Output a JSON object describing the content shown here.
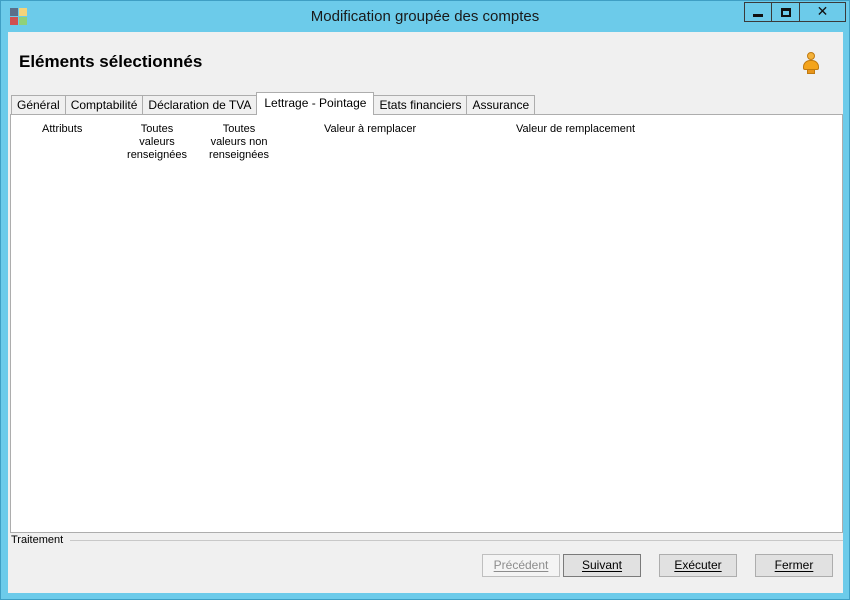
{
  "window": {
    "title": "Modification groupée des comptes",
    "controls": {
      "minimize": "minimize-icon",
      "maximize": "maximize-icon",
      "close": "close-icon"
    }
  },
  "header": {
    "title": "Eléments sélectionnés",
    "user_icon": "user-icon"
  },
  "tabs": [
    {
      "label": "Général",
      "active": false
    },
    {
      "label": "Comptabilité",
      "active": false
    },
    {
      "label": "Déclaration de TVA",
      "active": false
    },
    {
      "label": "Lettrage - Pointage",
      "active": true
    },
    {
      "label": "Etats financiers",
      "active": false
    },
    {
      "label": "Assurance",
      "active": false
    }
  ],
  "grid": {
    "columns": {
      "attributes": "Attributs",
      "all_filled": [
        "Toutes",
        "valeurs",
        "renseignées"
      ],
      "all_unfilled": [
        "Toutes",
        "valeurs non",
        "renseignées"
      ],
      "value_to_replace": "Valeur à remplacer",
      "replacement_value": "Valeur de remplacement"
    }
  },
  "processing": {
    "label": "Traitement",
    "buttons": {
      "previous": "Précédent",
      "next": "Suivant",
      "execute": "Exécuter",
      "close": "Fermer"
    }
  },
  "colors": {
    "title_bar": "#6ccbea",
    "client_bg": "#f0f0f0",
    "panel_bg": "#ffffff",
    "user_icon": "#f4a41c"
  }
}
